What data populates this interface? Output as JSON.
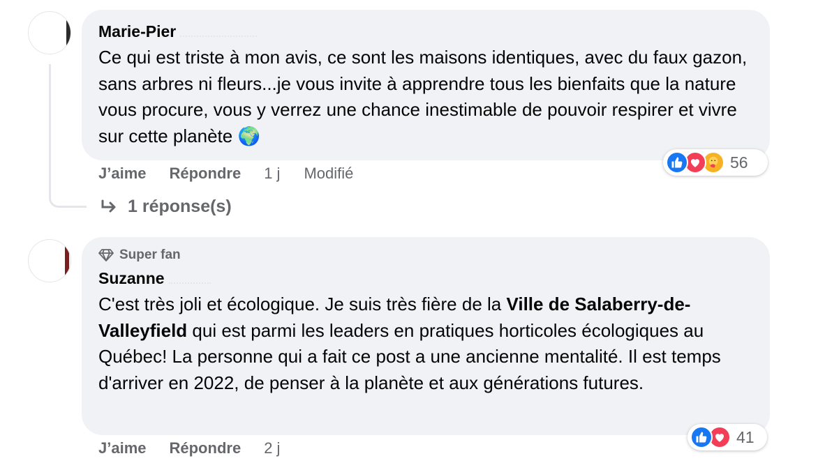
{
  "comments": [
    {
      "author": "Marie-Pier",
      "text": "Ce qui est triste à mon avis, ce sont les maisons identiques, avec du faux gazon, sans arbres ni fleurs...je vous invite à apprendre tous les bienfaits que la nature vous procure, vous y verrez une chance inestimable de pouvoir respirer et vivre sur cette planète",
      "emoji": "🌍",
      "reactions": {
        "icons": [
          "like-icon",
          "love-icon",
          "care-icon"
        ],
        "count": "56"
      },
      "actions": {
        "like": "J’aime",
        "reply": "Répondre",
        "time": "1 j",
        "edited": "Modifié"
      },
      "replies_label": "1 réponse(s)"
    },
    {
      "badge": "Super fan",
      "author": "Suzanne",
      "text_before": "C'est très joli et écologique. Je suis très fière de la ",
      "text_mention": "Ville de Salaberry-de-Valleyfield",
      "text_after": " qui est parmi les leaders en pratiques horticoles écologiques au Québec! La personne qui a fait ce post a une ancienne mentalité. Il est temps d'arriver en 2022, de penser à la planète et aux générations futures.",
      "reactions": {
        "icons": [
          "like-icon",
          "love-icon"
        ],
        "count": "41"
      },
      "actions": {
        "like": "J’aime",
        "reply": "Répondre",
        "time": "2 j"
      }
    }
  ],
  "colors": {
    "like": "#1877f2",
    "love": "#f33e58",
    "care": "#f7b125",
    "muted": "#65676b",
    "bubble": "#f0f2f5"
  }
}
